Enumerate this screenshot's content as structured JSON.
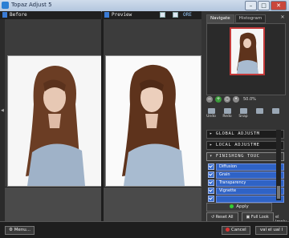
{
  "window": {
    "title": "Topaz Adjust 5"
  },
  "before_pane": {
    "label": "Before"
  },
  "preview_pane": {
    "label": "Preview",
    "extra_label": "ORE"
  },
  "right_panel": {
    "tabs": [
      "Navigate",
      "Histogram"
    ],
    "close_glyph": "✕",
    "zoom": {
      "value": "50.0%"
    },
    "tools": [
      {
        "label": "Undo"
      },
      {
        "label": "Redo"
      },
      {
        "label": "Snap"
      },
      {
        "label": ""
      },
      {
        "label": ""
      }
    ],
    "sections": [
      {
        "label": "GLOBAL ADJUSTM"
      },
      {
        "label": "LOCAL ADJUSTME"
      },
      {
        "label": "FINISHING TOUC"
      }
    ],
    "finishing_items": [
      "Diffusion",
      "Grain",
      "Transparency",
      "Vignette",
      ""
    ],
    "apply_label": "Apply",
    "reset_label": "Reset All",
    "fullscreen_label": "Full Look"
  },
  "overflow_text": "el Imply",
  "footer": {
    "menu_label": "Menu...",
    "cancel_label": "Cancel",
    "ok_label": "val el ual l"
  }
}
